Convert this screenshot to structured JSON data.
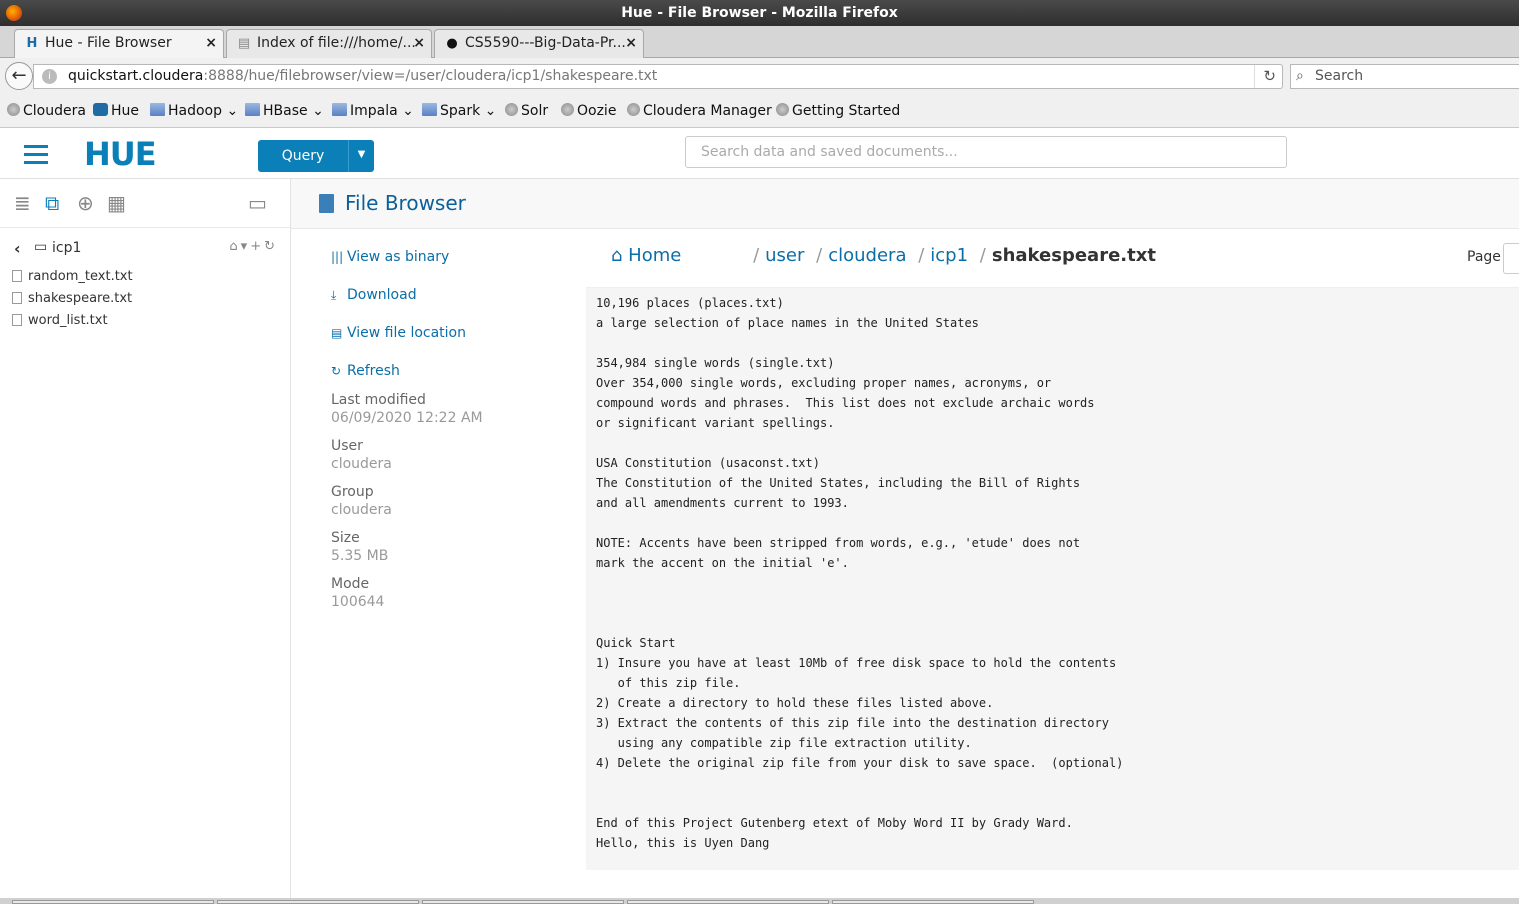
{
  "window": {
    "title": "Hue - File Browser - Mozilla Firefox"
  },
  "tabs": [
    {
      "label": "Hue - File Browser",
      "close": "×"
    },
    {
      "label": "Index of file:///home/...",
      "close": "×"
    },
    {
      "label": "CS5590---Big-Data-Pr...",
      "close": "×"
    }
  ],
  "newtab_label": "+",
  "address": {
    "host": "quickstart.cloudera",
    "path": ":8888/hue/filebrowser/view=/user/cloudera/icp1/shakespeare.txt"
  },
  "search": {
    "placeholder": "Search"
  },
  "bookmarks": [
    "Cloudera",
    "Hue",
    "Hadoop",
    "HBase",
    "Impala",
    "Spark",
    "Solr",
    "Oozie",
    "Cloudera Manager",
    "Getting Started"
  ],
  "hue": {
    "logo": "HUE",
    "query_label": "Query",
    "search_placeholder": "Search data and saved documents..."
  },
  "sidebar": {
    "folder": "icp1",
    "files": [
      "random_text.txt",
      "shakespeare.txt",
      "word_list.txt"
    ]
  },
  "filebrowser": {
    "title": "File Browser",
    "actions": [
      "View as binary",
      "Download",
      "View file location",
      "Refresh"
    ],
    "meta": [
      {
        "label": "Last modified",
        "value": "06/09/2020 12:22 AM"
      },
      {
        "label": "User",
        "value": "cloudera"
      },
      {
        "label": "Group",
        "value": "cloudera"
      },
      {
        "label": "Size",
        "value": "5.35 MB"
      },
      {
        "label": "Mode",
        "value": "100644"
      }
    ],
    "breadcrumb": {
      "home": "Home",
      "parts": [
        "user",
        "cloudera",
        "icp1"
      ],
      "current": "shakespeare.txt"
    },
    "page_label": "Page",
    "content": "10,196 places (places.txt)\na large selection of place names in the United States\n\n354,984 single words (single.txt)\nOver 354,000 single words, excluding proper names, acronyms, or\ncompound words and phrases.  This list does not exclude archaic words\nor significant variant spellings.\n\nUSA Constitution (usaconst.txt)\nThe Constitution of the United States, including the Bill of Rights\nand all amendments current to 1993.\n\nNOTE: Accents have been stripped from words, e.g., 'etude' does not\nmark the accent on the initial 'e'.\n\n\n\nQuick Start\n1) Insure you have at least 10Mb of free disk space to hold the contents\n   of this zip file.\n2) Create a directory to hold these files listed above.\n3) Extract the contents of this zip file into the destination directory\n   using any compatible zip file extraction utility.\n4) Delete the original zip file from your disk to save space.  (optional)\n\n\nEnd of this Project Gutenberg etext of Moby Word II by Grady Ward.\nHello, this is Uyen Dang"
  },
  "colors": {
    "accent": "#0b7fb8",
    "link": "#0b6ea8"
  }
}
